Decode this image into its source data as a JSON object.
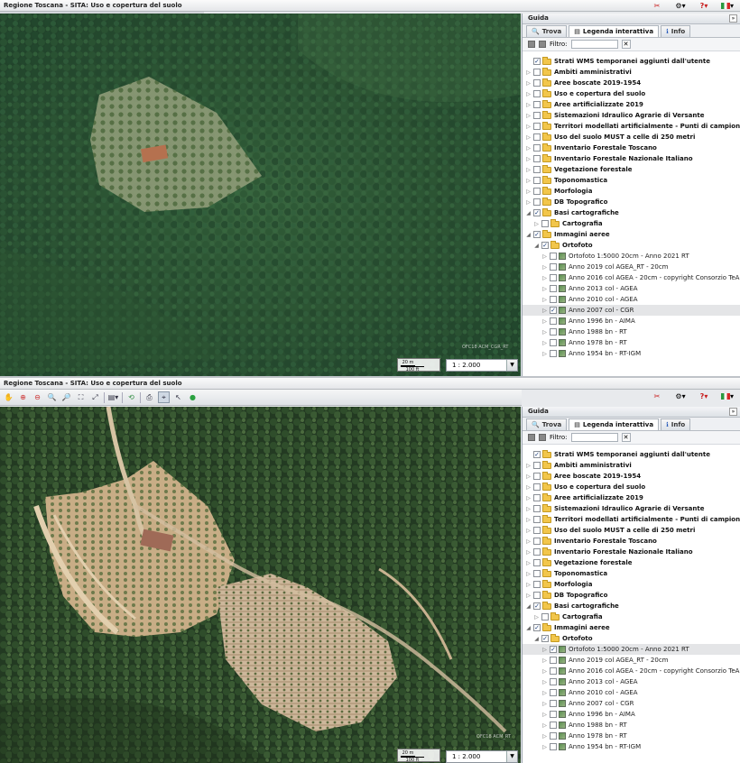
{
  "app": {
    "title": "Regione Toscana - SITA: Uso e copertura del suolo"
  },
  "top_icons": [
    "tools-icon",
    "settings-icon",
    "help-icon",
    "italian-flag-icon"
  ],
  "sidebar": {
    "header": "Guida",
    "tabs": [
      {
        "label": "Trova",
        "icon": "search-icon",
        "selected": false
      },
      {
        "label": "Legenda interattiva",
        "icon": "legend-icon",
        "selected": true
      },
      {
        "label": "Info",
        "icon": "info-icon",
        "selected": false
      }
    ],
    "filter_label": "Filtro:",
    "filter_value": ""
  },
  "panels": [
    {
      "map": {
        "scale_label": "1 : 2.000",
        "scalebar_m": "20 m",
        "scalebar_ft": "100 ft",
        "attribution": "OFC18 ACM_CGR_RT",
        "imagery": "forest-dense"
      },
      "tree": [
        {
          "level": 0,
          "label": "Strati WMS temporanei aggiunti dall'utente",
          "checked": true,
          "bold": true,
          "expander": "",
          "kind": "folder"
        },
        {
          "level": 0,
          "label": "Ambiti amministrativi",
          "checked": false,
          "bold": true,
          "expander": "▷",
          "kind": "folder"
        },
        {
          "level": 0,
          "label": "Aree boscate 2019-1954",
          "checked": false,
          "bold": true,
          "expander": "▷",
          "kind": "folder"
        },
        {
          "level": 0,
          "label": "Uso e copertura del suolo",
          "checked": false,
          "bold": true,
          "expander": "▷",
          "kind": "folder"
        },
        {
          "level": 0,
          "label": "Aree artificializzate 2019",
          "checked": false,
          "bold": true,
          "expander": "▷",
          "kind": "folder"
        },
        {
          "level": 0,
          "label": "Sistemazioni Idraulico Agrarie di Versante",
          "checked": false,
          "bold": true,
          "expander": "▷",
          "kind": "folder"
        },
        {
          "level": 0,
          "label": "Territori modellati artificialmente - Punti di campionamento",
          "checked": false,
          "bold": true,
          "expander": "▷",
          "kind": "folder"
        },
        {
          "level": 0,
          "label": "Uso del suolo MUST a celle di 250 metri",
          "checked": false,
          "bold": true,
          "expander": "▷",
          "kind": "folder"
        },
        {
          "level": 0,
          "label": "Inventario Forestale Toscano",
          "checked": false,
          "bold": true,
          "expander": "▷",
          "kind": "folder"
        },
        {
          "level": 0,
          "label": "Inventario Forestale Nazionale Italiano",
          "checked": false,
          "bold": true,
          "expander": "▷",
          "kind": "folder"
        },
        {
          "level": 0,
          "label": "Vegetazione forestale",
          "checked": false,
          "bold": true,
          "expander": "▷",
          "kind": "folder"
        },
        {
          "level": 0,
          "label": "Toponomastica",
          "checked": false,
          "bold": true,
          "expander": "▷",
          "kind": "folder"
        },
        {
          "level": 0,
          "label": "Morfologia",
          "checked": false,
          "bold": true,
          "expander": "▷",
          "kind": "folder"
        },
        {
          "level": 0,
          "label": "DB Topografico",
          "checked": false,
          "bold": true,
          "expander": "▷",
          "kind": "folder"
        },
        {
          "level": 0,
          "label": "Basi cartografiche",
          "checked": true,
          "bold": true,
          "expander": "◢",
          "kind": "folder"
        },
        {
          "level": 1,
          "label": "Cartografia",
          "checked": false,
          "bold": true,
          "expander": "▷",
          "kind": "folder"
        },
        {
          "level": 0,
          "label": "Immagini aeree",
          "checked": true,
          "bold": true,
          "expander": "◢",
          "kind": "folder"
        },
        {
          "level": 1,
          "label": "Ortofoto",
          "checked": true,
          "bold": true,
          "expander": "◢",
          "kind": "folder"
        },
        {
          "level": 2,
          "label": "Ortofoto 1:5000 20cm - Anno 2021 RT",
          "checked": false,
          "bold": false,
          "expander": "▷",
          "kind": "layer"
        },
        {
          "level": 2,
          "label": "Anno 2019 col AGEA_RT - 20cm",
          "checked": false,
          "bold": false,
          "expander": "▷",
          "kind": "layer"
        },
        {
          "level": 2,
          "label": "Anno 2016 col AGEA - 20cm - copyright Consorzio TeA",
          "checked": false,
          "bold": false,
          "expander": "▷",
          "kind": "layer"
        },
        {
          "level": 2,
          "label": "Anno 2013 col - AGEA",
          "checked": false,
          "bold": false,
          "expander": "▷",
          "kind": "layer"
        },
        {
          "level": 2,
          "label": "Anno 2010 col - AGEA",
          "checked": false,
          "bold": false,
          "expander": "▷",
          "kind": "layer"
        },
        {
          "level": 2,
          "label": "Anno 2007 col - CGR",
          "checked": true,
          "bold": false,
          "expander": "▷",
          "kind": "layer",
          "selected": true
        },
        {
          "level": 2,
          "label": "Anno 1996 bn - AIMA",
          "checked": false,
          "bold": false,
          "expander": "▷",
          "kind": "layer"
        },
        {
          "level": 2,
          "label": "Anno 1988 bn - RT",
          "checked": false,
          "bold": false,
          "expander": "▷",
          "kind": "layer"
        },
        {
          "level": 2,
          "label": "Anno 1978 bn - RT",
          "checked": false,
          "bold": false,
          "expander": "▷",
          "kind": "layer"
        },
        {
          "level": 2,
          "label": "Anno 1954 bn - RT-IGM",
          "checked": false,
          "bold": false,
          "expander": "▷",
          "kind": "layer"
        }
      ]
    },
    {
      "map": {
        "scale_label": "1 : 2.000",
        "scalebar_m": "20 m",
        "scalebar_ft": "100 ft",
        "attribution": "OFC18 ACM_RT",
        "imagery": "terraced-hill"
      },
      "tree": [
        {
          "level": 0,
          "label": "Strati WMS temporanei aggiunti dall'utente",
          "checked": true,
          "bold": true,
          "expander": "",
          "kind": "folder"
        },
        {
          "level": 0,
          "label": "Ambiti amministrativi",
          "checked": false,
          "bold": true,
          "expander": "▷",
          "kind": "folder"
        },
        {
          "level": 0,
          "label": "Aree boscate 2019-1954",
          "checked": false,
          "bold": true,
          "expander": "▷",
          "kind": "folder"
        },
        {
          "level": 0,
          "label": "Uso e copertura del suolo",
          "checked": false,
          "bold": true,
          "expander": "▷",
          "kind": "folder"
        },
        {
          "level": 0,
          "label": "Aree artificializzate 2019",
          "checked": false,
          "bold": true,
          "expander": "▷",
          "kind": "folder"
        },
        {
          "level": 0,
          "label": "Sistemazioni Idraulico Agrarie di Versante",
          "checked": false,
          "bold": true,
          "expander": "▷",
          "kind": "folder"
        },
        {
          "level": 0,
          "label": "Territori modellati artificialmente - Punti di campionamento",
          "checked": false,
          "bold": true,
          "expander": "▷",
          "kind": "folder"
        },
        {
          "level": 0,
          "label": "Uso del suolo MUST a celle di 250 metri",
          "checked": false,
          "bold": true,
          "expander": "▷",
          "kind": "folder"
        },
        {
          "level": 0,
          "label": "Inventario Forestale Toscano",
          "checked": false,
          "bold": true,
          "expander": "▷",
          "kind": "folder"
        },
        {
          "level": 0,
          "label": "Inventario Forestale Nazionale Italiano",
          "checked": false,
          "bold": true,
          "expander": "▷",
          "kind": "folder"
        },
        {
          "level": 0,
          "label": "Vegetazione forestale",
          "checked": false,
          "bold": true,
          "expander": "▷",
          "kind": "folder"
        },
        {
          "level": 0,
          "label": "Toponomastica",
          "checked": false,
          "bold": true,
          "expander": "▷",
          "kind": "folder"
        },
        {
          "level": 0,
          "label": "Morfologia",
          "checked": false,
          "bold": true,
          "expander": "▷",
          "kind": "folder"
        },
        {
          "level": 0,
          "label": "DB Topografico",
          "checked": false,
          "bold": true,
          "expander": "▷",
          "kind": "folder"
        },
        {
          "level": 0,
          "label": "Basi cartografiche",
          "checked": true,
          "bold": true,
          "expander": "◢",
          "kind": "folder"
        },
        {
          "level": 1,
          "label": "Cartografia",
          "checked": false,
          "bold": true,
          "expander": "▷",
          "kind": "folder"
        },
        {
          "level": 0,
          "label": "Immagini aeree",
          "checked": true,
          "bold": true,
          "expander": "◢",
          "kind": "folder"
        },
        {
          "level": 1,
          "label": "Ortofoto",
          "checked": true,
          "bold": true,
          "expander": "◢",
          "kind": "folder"
        },
        {
          "level": 2,
          "label": "Ortofoto 1:5000 20cm - Anno 2021 RT",
          "checked": true,
          "bold": false,
          "expander": "▷",
          "kind": "layer",
          "selected": true
        },
        {
          "level": 2,
          "label": "Anno 2019 col AGEA_RT - 20cm",
          "checked": false,
          "bold": false,
          "expander": "▷",
          "kind": "layer"
        },
        {
          "level": 2,
          "label": "Anno 2016 col AGEA - 20cm - copyright Consorzio TeA",
          "checked": false,
          "bold": false,
          "expander": "▷",
          "kind": "layer"
        },
        {
          "level": 2,
          "label": "Anno 2013 col - AGEA",
          "checked": false,
          "bold": false,
          "expander": "▷",
          "kind": "layer"
        },
        {
          "level": 2,
          "label": "Anno 2010 col - AGEA",
          "checked": false,
          "bold": false,
          "expander": "▷",
          "kind": "layer"
        },
        {
          "level": 2,
          "label": "Anno 2007 col - CGR",
          "checked": false,
          "bold": false,
          "expander": "▷",
          "kind": "layer"
        },
        {
          "level": 2,
          "label": "Anno 1996 bn - AIMA",
          "checked": false,
          "bold": false,
          "expander": "▷",
          "kind": "layer"
        },
        {
          "level": 2,
          "label": "Anno 1988 bn - RT",
          "checked": false,
          "bold": false,
          "expander": "▷",
          "kind": "layer"
        },
        {
          "level": 2,
          "label": "Anno 1978 bn - RT",
          "checked": false,
          "bold": false,
          "expander": "▷",
          "kind": "layer"
        },
        {
          "level": 2,
          "label": "Anno 1954 bn - RT-IGM",
          "checked": false,
          "bold": false,
          "expander": "▷",
          "kind": "layer"
        }
      ]
    }
  ],
  "toolbar_icons": [
    "pan-icon",
    "zoom-in-box-icon",
    "zoom-out-box-icon",
    "zoom-in-icon",
    "zoom-out-icon",
    "zoom-extent-icon",
    "zoom-prev-icon",
    "layers-menu-icon",
    "back-icon",
    "print-icon",
    "identify-icon",
    "measure-icon",
    "globe-icon"
  ],
  "colors": {
    "accent_red": "#c81e1e",
    "panel_bg": "#e8eaed",
    "selected_row": "#e4e5e7"
  }
}
